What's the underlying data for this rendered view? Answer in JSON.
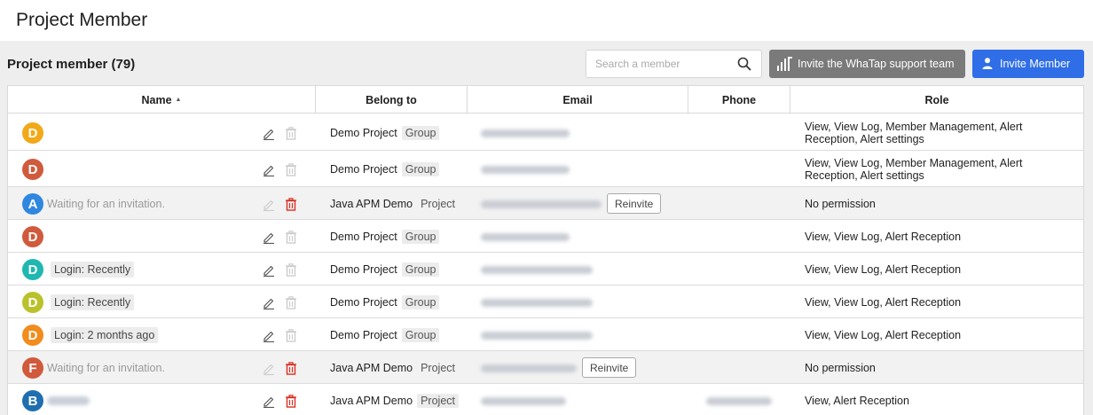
{
  "page": {
    "title": "Project Member"
  },
  "toolbar": {
    "section_title": "Project member (79)",
    "search_placeholder": "Search a member",
    "support_button_label": "Invite the WhaTap support team",
    "invite_button_label": "Invite Member"
  },
  "table": {
    "columns": [
      "Name",
      "Belong to",
      "Email",
      "Phone",
      "Role"
    ],
    "sort_indicator": "▲",
    "rows": [
      {
        "initial": "D",
        "avatar_color": "#f2a918",
        "status": "",
        "status_type": "none",
        "project": "Demo Project",
        "type": "Group",
        "reinvite": "",
        "role": "View, View Log, Member Management, Alert Reception, Alert settings"
      },
      {
        "initial": "D",
        "avatar_color": "#d05a3c",
        "status": "",
        "status_type": "none",
        "project": "Demo Project",
        "type": "Group",
        "reinvite": "",
        "role": "View, View Log, Member Management, Alert Reception, Alert settings"
      },
      {
        "initial": "A",
        "avatar_color": "#2f87e0",
        "status": "Waiting for an invitation.",
        "status_type": "waiting",
        "project": "Java APM Demo",
        "type": "Project",
        "reinvite": "Reinvite",
        "role": "No permission"
      },
      {
        "initial": "D",
        "avatar_color": "#d05a3c",
        "status": "",
        "status_type": "none",
        "project": "Demo Project",
        "type": "Group",
        "reinvite": "",
        "role": "View, View Log, Alert Reception"
      },
      {
        "initial": "D",
        "avatar_color": "#1fb8b0",
        "status": "Login: Recently",
        "status_type": "login",
        "project": "Demo Project",
        "type": "Group",
        "reinvite": "",
        "role": "View, View Log, Alert Reception"
      },
      {
        "initial": "D",
        "avatar_color": "#b9c22a",
        "status": "Login: Recently",
        "status_type": "login",
        "project": "Demo Project",
        "type": "Group",
        "reinvite": "",
        "role": "View, View Log, Alert Reception"
      },
      {
        "initial": "D",
        "avatar_color": "#f28c1c",
        "status": "Login: 2 months ago",
        "status_type": "login",
        "project": "Demo Project",
        "type": "Group",
        "reinvite": "",
        "role": "View, View Log, Alert Reception"
      },
      {
        "initial": "F",
        "avatar_color": "#d05a3c",
        "status": "Waiting for an invitation.",
        "status_type": "waiting",
        "project": "Java APM Demo",
        "type": "Project",
        "reinvite": "Reinvite",
        "role": "No permission"
      },
      {
        "initial": "B",
        "avatar_color": "#1f6fb0",
        "status": "",
        "status_type": "blurred",
        "project": "Java APM Demo",
        "type": "Project",
        "reinvite": "",
        "role": "View, Alert Reception"
      }
    ]
  }
}
